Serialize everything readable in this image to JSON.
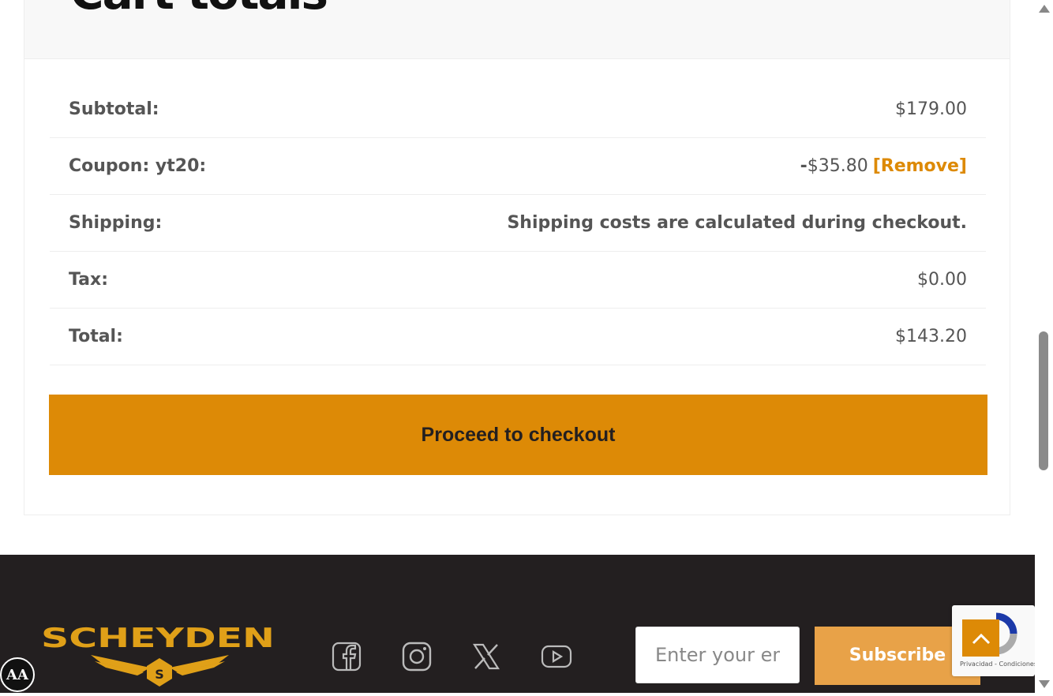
{
  "cart": {
    "title": "Cart totals",
    "rows": [
      {
        "label": "Subtotal:",
        "value": "$179.00"
      },
      {
        "label": "Coupon: yt20:",
        "minus": "-",
        "value": "$35.80",
        "remove": "[Remove]"
      },
      {
        "label": "Shipping:",
        "value": "Shipping costs are calculated during checkout."
      },
      {
        "label": "Tax:",
        "value": "$0.00"
      },
      {
        "label": "Total:",
        "value": "$143.20"
      }
    ],
    "checkout_label": "Proceed to checkout"
  },
  "footer": {
    "brand": "SCHEYDEN",
    "logo_letter": "S",
    "social": [
      "facebook-icon",
      "instagram-icon",
      "x-icon",
      "youtube-icon"
    ],
    "email_placeholder": "Enter your email",
    "subscribe_label": "Subscribe"
  },
  "recaptcha": {
    "terms": "Privacidad - Condiciones"
  },
  "a11y_label": "AA",
  "colors": {
    "accent": "#dd8a06",
    "footer_bg": "#231f20",
    "subscribe": "#e8a248"
  }
}
